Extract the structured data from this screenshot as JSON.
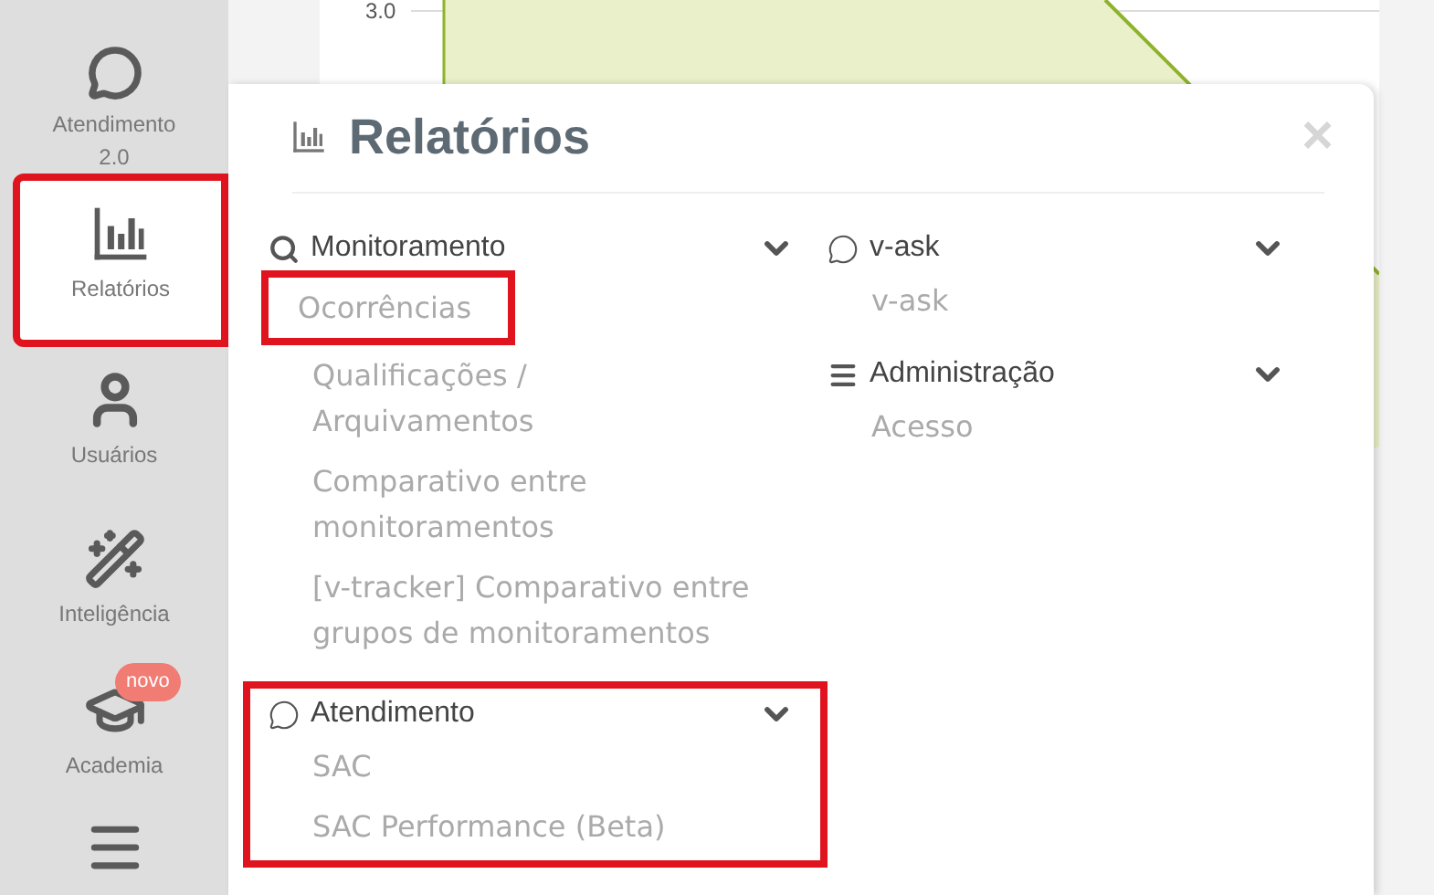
{
  "sidebar": {
    "items": [
      {
        "kind": "chat",
        "label": "Atendimento 2.0",
        "selected": false,
        "highlighted": false
      },
      {
        "kind": "reports",
        "label": "Relatórios",
        "selected": true,
        "highlighted": true
      },
      {
        "kind": "user",
        "label": "Usuários",
        "selected": false,
        "highlighted": false
      },
      {
        "kind": "wand",
        "label": "Inteligência",
        "selected": false,
        "highlighted": false
      },
      {
        "kind": "academy",
        "label": "Academia",
        "badge": "novo",
        "selected": false,
        "highlighted": false
      },
      {
        "kind": "menu",
        "selected": false,
        "highlighted": false
      }
    ]
  },
  "background_chart": {
    "y_tick_label": "3.0"
  },
  "panel": {
    "title": "Relatórios",
    "close": "×",
    "columns": [
      [
        {
          "kind": "search",
          "heading": "Monitoramento",
          "highlighted": false,
          "items": [
            {
              "label": "Ocorrências",
              "highlighted": true
            },
            {
              "label": "Qualificações / Arquivamentos",
              "highlighted": false
            },
            {
              "label": "Comparativo entre monitoramentos",
              "highlighted": false
            },
            {
              "label": "[v-tracker] Comparativo entre grupos de monitoramentos",
              "highlighted": false
            }
          ]
        },
        {
          "kind": "chat",
          "heading": "Atendimento",
          "highlighted": true,
          "items": [
            {
              "label": "SAC",
              "highlighted": false
            },
            {
              "label": "SAC Performance (Beta)",
              "highlighted": false
            }
          ]
        }
      ],
      [
        {
          "kind": "chat",
          "heading": "v-ask",
          "highlighted": false,
          "items": [
            {
              "label": "v-ask",
              "highlighted": false
            }
          ]
        },
        {
          "kind": "list",
          "heading": "Administração",
          "highlighted": false,
          "items": [
            {
              "label": "Acesso",
              "highlighted": false
            }
          ]
        }
      ]
    ]
  }
}
